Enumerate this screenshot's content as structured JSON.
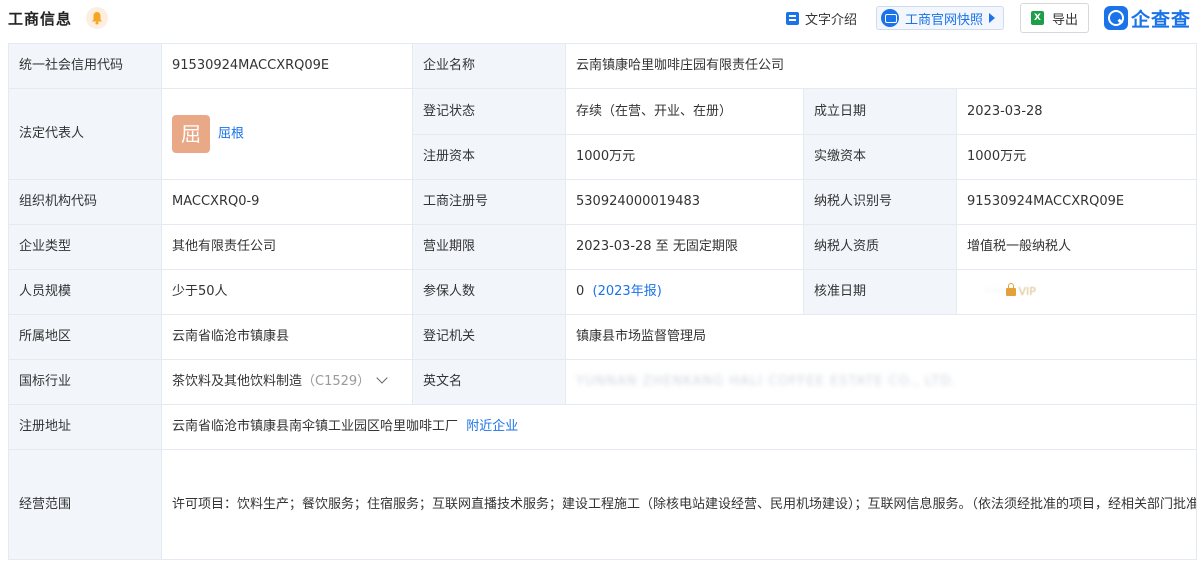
{
  "header": {
    "title": "工商信息",
    "text_intro": "文字介绍",
    "snapshot": "工商官网快照",
    "export": "导出",
    "export_icon_text": "X",
    "logo": "企查查"
  },
  "rows": {
    "credit_code_label": "统一社会信用代码",
    "credit_code": "91530924MACCXRQ09E",
    "company_name_label": "企业名称",
    "company_name": "云南镇康哈里咖啡庄园有限责任公司",
    "legal_rep_label": "法定代表人",
    "legal_rep_avatar": "屈",
    "legal_rep": "屈根",
    "reg_status_label": "登记状态",
    "reg_status": "存续（在营、开业、在册）",
    "founded_label": "成立日期",
    "founded": "2023-03-28",
    "reg_capital_label": "注册资本",
    "reg_capital": "1000万元",
    "paid_capital_label": "实缴资本",
    "paid_capital": "1000万元",
    "org_code_label": "组织机构代码",
    "org_code": "MACCXRQ0-9",
    "biz_reg_no_label": "工商注册号",
    "biz_reg_no": "530924000019483",
    "taxpayer_id_label": "纳税人识别号",
    "taxpayer_id": "91530924MACCXRQ09E",
    "company_type_label": "企业类型",
    "company_type": "其他有限责任公司",
    "biz_term_label": "营业期限",
    "biz_term": "2023-03-28 至 无固定期限",
    "taxpayer_qual_label": "纳税人资质",
    "taxpayer_qual": "增值税一般纳税人",
    "staff_size_label": "人员规模",
    "staff_size": "少于50人",
    "insured_label": "参保人数",
    "insured": "0",
    "insured_report": "(2023年报)",
    "approve_date_label": "核准日期",
    "approve_date_masked": "VIP",
    "region_label": "所属地区",
    "region": "云南省临沧市镇康县",
    "reg_authority_label": "登记机关",
    "reg_authority": "镇康县市场监督管理局",
    "industry_label": "国标行业",
    "industry": "茶饮料及其他饮料制造",
    "industry_code": "（C1529）",
    "english_name_label": "英文名",
    "english_name_masked": "YUNNAN ZHENKANG HALI COFFEE ESTATE CO., LTD.",
    "address_label": "注册地址",
    "address": "云南省临沧市镇康县南伞镇工业园区哈里咖啡工厂",
    "nearby": "附近企业",
    "scope_label": "经营范围",
    "scope": "许可项目：饮料生产；餐饮服务；住宿服务；互联网直播技术服务；建设工程施工（除核电站建设经营、民用机场建设）；互联网信息服务。（依法须经批准的项目，经相关部门批准后方可开展经营活动，具体经营项目以相关部门批准文件或许可证件为准）一般项目：咖啡豆种植；坚果种植；未经加工的坚果、干果销售；农副产品销售；食用农产品初加工；食用农产品零售；食用农产品批发；货物进出口；食品进出口；休闲观光活动；个人互联网直播服务；酒店管理；工程管理服务；工程造价咨询业务；工程技术服务（规划管理、勘察、设计、监理除外）；劳务服务（不含劳务派遣）；对外承包工程；土石方工程施工；体育场地设施工程施工；机械设备租赁；建筑材料销售。（除依法须经批准的项目外，凭营业执照依法自主开展经营活动）"
  },
  "colors": {
    "accent": "#1a73e8",
    "label_bg": "#f2f6fb",
    "border": "#e4eaf2",
    "avatar_bg": "#e9a987"
  }
}
